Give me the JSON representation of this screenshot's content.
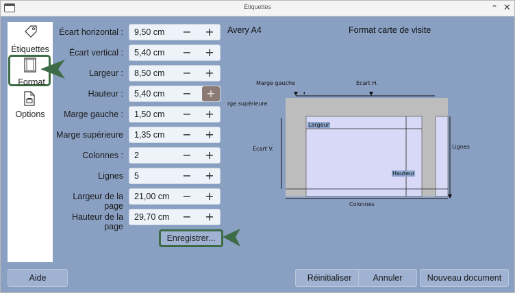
{
  "window": {
    "title": "Étiquettes",
    "chevron": "⌃",
    "close": "✕"
  },
  "sidebar": {
    "items": [
      {
        "label": "Étiquettes",
        "icon": "tag-icon"
      },
      {
        "label": "Format",
        "icon": "page-format-icon",
        "selected": true
      },
      {
        "label": "Options",
        "icon": "printer-options-icon"
      }
    ]
  },
  "form": {
    "fields": [
      {
        "label": "Écart horizontal :",
        "value": "9,50 cm"
      },
      {
        "label": "Écart vertical :",
        "value": "5,40 cm"
      },
      {
        "label": "Largeur :",
        "value": "8,50 cm"
      },
      {
        "label": "Hauteur :",
        "value": "5,40 cm"
      },
      {
        "label": "Marge gauche :",
        "value": "1,50 cm"
      },
      {
        "label": "Marge supérieure",
        "value": "1,35 cm"
      },
      {
        "label": "Colonnes :",
        "value": "2"
      },
      {
        "label": "Lignes",
        "value": "5"
      },
      {
        "label": "Largeur de la page",
        "value": "21,00 cm"
      },
      {
        "label": "Hauteur de la page",
        "value": "29,70 cm"
      }
    ],
    "minus": "−",
    "plus": "+",
    "save_label": "Enregistrer..."
  },
  "preview": {
    "model_name": "Avery A4",
    "model_type": "Format carte de visite",
    "labels": {
      "left_margin": "Marge gauche",
      "h_gap": "Écart H.",
      "top_margin": "rge supérieure",
      "v_gap": "Écart V.",
      "width": "Largeur",
      "height": "Hauteur",
      "rows": "Lignes",
      "columns": "Colonnes"
    }
  },
  "buttons": {
    "help": "Aide",
    "reset": "Réinitialiser",
    "cancel": "Annuler",
    "new_document": "Nouveau document"
  },
  "colors": {
    "background": "#8aa0c3",
    "accent_frame": "#3d6b45",
    "button": "#9fb2d2"
  }
}
